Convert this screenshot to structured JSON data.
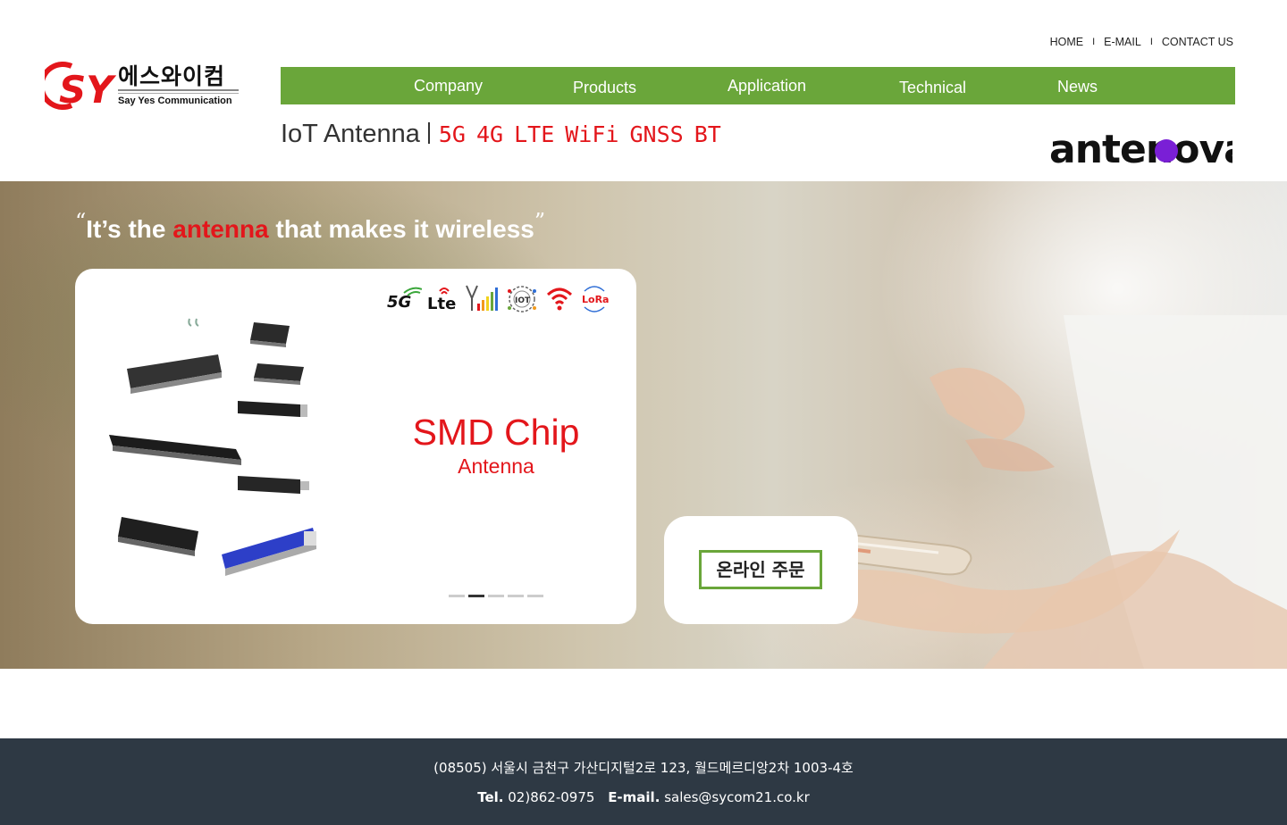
{
  "util_nav": {
    "home": "HOME",
    "email": "E-MAIL",
    "contact": "CONTACT US",
    "separator": "I"
  },
  "logo": {
    "mark": "SY",
    "korean": "에스와이컴",
    "english": "Say Yes Communication",
    "mark_color": "#e3161b"
  },
  "main_nav": {
    "items": [
      {
        "label": "Company"
      },
      {
        "label": "Products"
      },
      {
        "label": "Application"
      },
      {
        "label": "Technical"
      },
      {
        "label": "News"
      }
    ],
    "background": "#6aa63a"
  },
  "iot": {
    "title": "IoT Antenna",
    "techs": [
      "5G",
      "4G",
      "LTE",
      "WiFi",
      "GNSS",
      "BT"
    ],
    "tech_color": "#e3161b"
  },
  "partner": {
    "logo_text": "antenova",
    "dot_color": "#7a1fd6"
  },
  "hero": {
    "slogan_prefix": "It’s the",
    "slogan_accent": "antenna",
    "slogan_suffix": "that makes it wireless",
    "open_quote": "“",
    "close_quote": "”"
  },
  "slider": {
    "icons": [
      "5g-icon",
      "lte-icon",
      "cellular-signal-icon",
      "iot-icon",
      "wifi-icon",
      "lora-icon"
    ],
    "icon_labels": {
      "five_g": "5G",
      "lte": "Lte",
      "iot": "IOT",
      "lora": "LoRa"
    },
    "title": "SMD Chip",
    "subtitle": "Antenna",
    "slide_count": 5,
    "active_slide": 2
  },
  "order": {
    "button_label": "온라인 주문",
    "border_color": "#6aa63a"
  },
  "footer": {
    "address": "(08505) 서울시 금천구 가산디지털2로 123, 월드메르디앙2차 1003-4호",
    "tel_label": "Tel.",
    "tel": "02)862-0975",
    "email_label": "E-mail.",
    "email": "sales@sycom21.co.kr",
    "background": "#2e3944"
  }
}
